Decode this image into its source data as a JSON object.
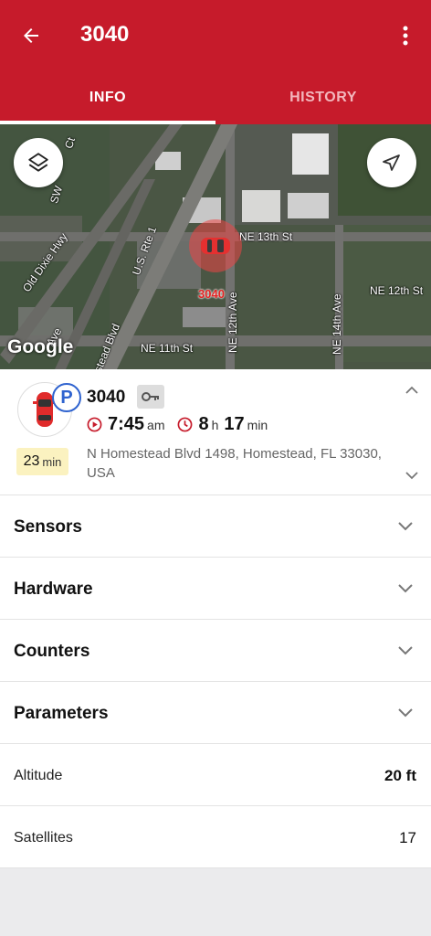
{
  "header": {
    "title": "3040"
  },
  "tabs": [
    {
      "label": "INFO",
      "active": true
    },
    {
      "label": "HISTORY",
      "active": false
    }
  ],
  "map": {
    "labels": {
      "ne13": "NE 13th St",
      "ne12": "NE 12th St",
      "ne11": "NE 11th St",
      "ne12ave": "NE 12th Ave",
      "ne14ave": "NE 14th Ave",
      "oldDixie": "Old Dixie Hwy",
      "usRte1": "U.S. Rte 1",
      "homesteadBlvd": "stead Blvd",
      "sw": "SW",
      "ct": "Ct",
      "ave": "Ave",
      "carId": "3040",
      "google": "Google"
    }
  },
  "vehicle": {
    "name": "3040",
    "parking": "P",
    "start_time": "7:45",
    "start_ampm": "am",
    "duration_h": "8",
    "duration_h_unit": "h",
    "duration_m": "17",
    "duration_m_unit": "min",
    "duration_badge": "23",
    "duration_badge_unit": "min",
    "address": "N Homestead Blvd 1498, Homestead, FL 33030, USA"
  },
  "sections": [
    {
      "label": "Sensors"
    },
    {
      "label": "Hardware"
    },
    {
      "label": "Counters"
    },
    {
      "label": "Parameters"
    }
  ],
  "info_rows": [
    {
      "label": "Altitude",
      "value": "20 ft"
    },
    {
      "label": "Satellites",
      "value": "17"
    }
  ],
  "colors": {
    "brand": "#c61b2b",
    "accent": "#2f63cf"
  }
}
